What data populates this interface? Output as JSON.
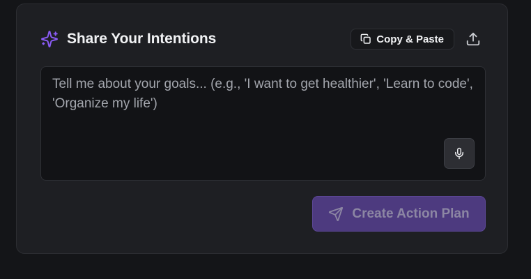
{
  "intentions_card": {
    "title": "Share Your Intentions",
    "title_icon": "sparkles-icon",
    "copy_paste_label": "Copy & Paste",
    "copy_icon": "copy-icon",
    "share_icon": "upload-share-icon",
    "input": {
      "value": "",
      "placeholder": "Tell me about your goals... (e.g., 'I want to get healthier', 'Learn to code', 'Organize my life')"
    },
    "mic_icon": "microphone-icon",
    "submit_label": "Create Action Plan",
    "submit_icon": "send-icon",
    "submit_disabled": true
  },
  "colors": {
    "page_bg": "#141518",
    "card_bg": "#1e1f23",
    "accent": "#8b5cf6",
    "button_disabled_bg": "#4d3a7f",
    "text_primary": "#f1f2f4",
    "text_placeholder": "#a3a6ad"
  }
}
